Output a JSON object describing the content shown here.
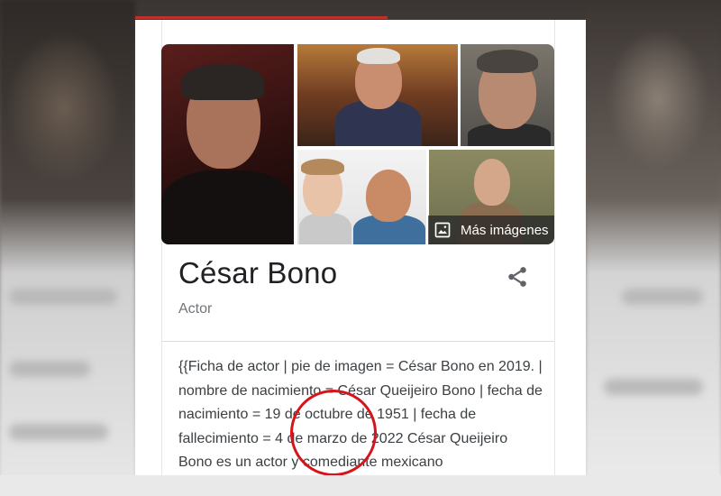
{
  "knowledge_panel": {
    "title": "César Bono",
    "subtitle": "Actor",
    "more_images_label": "Más imágenes",
    "description": "{{Ficha de actor | pie de imagen = César Bono en 2019. | nombre de nacimiento = César Queijeiro Bono | fecha de nacimiento = 19 de octubre de 1951 | fecha de fallecimiento = 4 de marzo de 2022 César Queijeiro Bono es un actor y comediante mexicano"
  },
  "icons": {
    "share": "share-icon",
    "image": "image-icon"
  },
  "colors": {
    "highlight_circle": "#d4161c",
    "title_text": "#202124",
    "subtitle_text": "#70757a",
    "accent_bar": "#c0312b"
  }
}
